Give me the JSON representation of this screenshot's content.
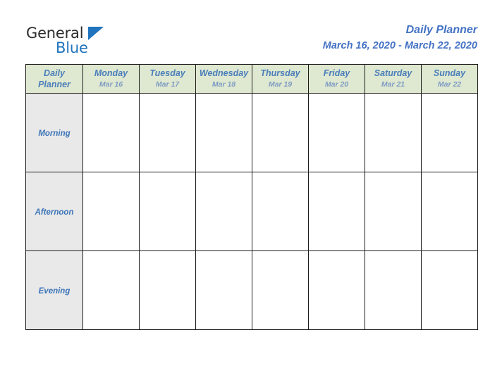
{
  "brand": {
    "name_primary": "General",
    "name_secondary": "Blue",
    "triangle_color": "#1f74bd",
    "primary_color": "#2d2d2d"
  },
  "header": {
    "title": "Daily Planner",
    "date_range": "March 16, 2020 - March 22, 2020",
    "accent_color": "#4472c4"
  },
  "table": {
    "corner": {
      "line1": "Daily",
      "line2": "Planner"
    },
    "header_bg": "#dfe8d0",
    "row_label_bg": "#e9e9e9",
    "day_name_color": "#4a7ebb",
    "day_date_color": "#7d9bc4",
    "columns": [
      {
        "day": "Monday",
        "date": "Mar 16"
      },
      {
        "day": "Tuesday",
        "date": "Mar 17"
      },
      {
        "day": "Wednesday",
        "date": "Mar 18"
      },
      {
        "day": "Thursday",
        "date": "Mar 19"
      },
      {
        "day": "Friday",
        "date": "Mar 20"
      },
      {
        "day": "Saturday",
        "date": "Mar 21"
      },
      {
        "day": "Sunday",
        "date": "Mar 22"
      }
    ],
    "rows": [
      {
        "label": "Morning",
        "cells": [
          "",
          "",
          "",
          "",
          "",
          "",
          ""
        ]
      },
      {
        "label": "Afternoon",
        "cells": [
          "",
          "",
          "",
          "",
          "",
          "",
          ""
        ]
      },
      {
        "label": "Evening",
        "cells": [
          "",
          "",
          "",
          "",
          "",
          "",
          ""
        ]
      }
    ]
  }
}
